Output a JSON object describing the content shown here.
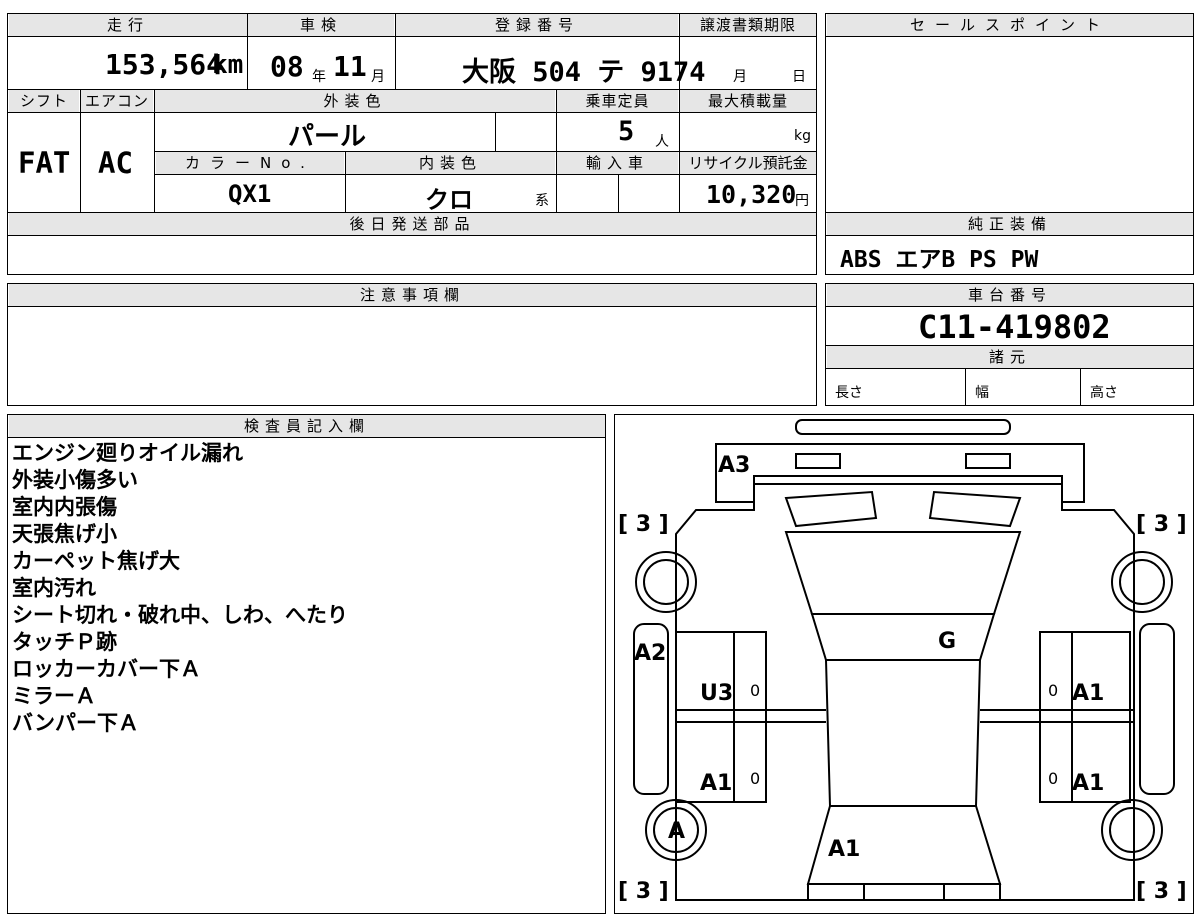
{
  "header_labels": {
    "mileage": "走行",
    "inspection": "車検",
    "registration": "登録番号",
    "transfer_deadline": "譲渡書類期限",
    "sales_point": "セールスポイント",
    "shift": "シフト",
    "aircon": "エアコン",
    "exterior_color": "外装色",
    "capacity": "乗車定員",
    "max_load": "最大積載量",
    "color_no": "カラーNo.",
    "interior_color": "内装色",
    "import": "輸入車",
    "recycle_fee": "リサイクル預託金",
    "parts_later": "後日発送部品",
    "genuine_equipment": "純正装備",
    "notes": "注意事項欄",
    "chassis_no": "車台番号",
    "specs": "諸元",
    "inspector_notes": "検査員記入欄"
  },
  "values": {
    "mileage": "153,564",
    "mileage_unit": "km",
    "inspection_year": "08",
    "year_unit": "年",
    "inspection_month": "11",
    "month_unit": "月",
    "registration": "大阪 504 テ 9174",
    "deadline_month": "月",
    "deadline_day": "日",
    "shift": "FAT",
    "aircon": "AC",
    "exterior_color": "パール",
    "capacity": "5",
    "capacity_unit": "人",
    "max_load_unit": "kg",
    "color_no": "QX1",
    "interior_color": "クロ",
    "interior_suffix": "系",
    "recycle_fee": "10,320",
    "recycle_unit": "円",
    "genuine_equipment": "ABS エアB PS PW",
    "chassis_no": "C11-419802",
    "spec_length": "長さ",
    "spec_width": "幅",
    "spec_height": "高さ"
  },
  "inspector_remarks": [
    "エンジン廻りオイル漏れ",
    "外装小傷多い",
    "室内内張傷",
    "天張焦げ小",
    "カーペット焦げ大",
    "室内汚れ",
    "シート切れ・破れ中、しわ、へたり",
    "タッチＰ跡",
    "ロッカーカバー下Ａ",
    "ミラーＡ",
    "バンパー下Ａ"
  ],
  "diagram_marks": {
    "front_bumper": "A3",
    "tire_fl": "[ 3 ]",
    "tire_fr": "[ 3 ]",
    "tire_rl": "[ 3 ]",
    "tire_rr": "[ 3 ]",
    "left_fender": "A2",
    "windshield": "G",
    "left_front_door": "U3",
    "right_front_door": "A1",
    "left_rear_door": "A1",
    "right_rear_door": "A1",
    "left_rear_wheel": "A",
    "tailgate": "A1",
    "door_zero": "0"
  }
}
